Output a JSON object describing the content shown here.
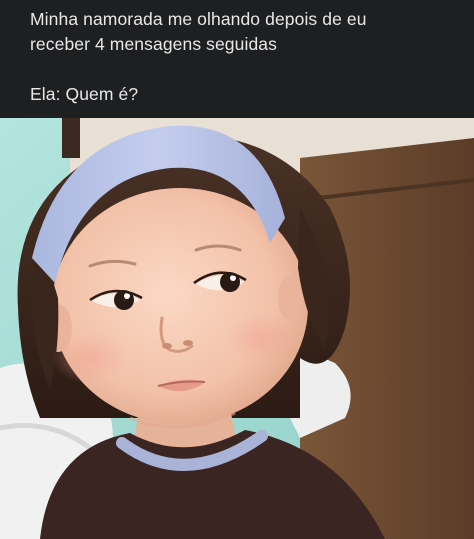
{
  "post": {
    "caption_line_1": "Minha namorada me olhando depois de eu",
    "caption_line_2": "receber 4 mensagens seguidas",
    "caption_line_3": "Ela: Quem é?"
  },
  "photo": {
    "icon": "meme-photo-child-side-eye"
  },
  "colors": {
    "background": "#1e1f21",
    "caption_text": "#e8e8e8",
    "headband": "#b9c4e6",
    "shirt": "#3b2522",
    "wall": "#a9dcd6",
    "wood": "#6b4a33"
  }
}
